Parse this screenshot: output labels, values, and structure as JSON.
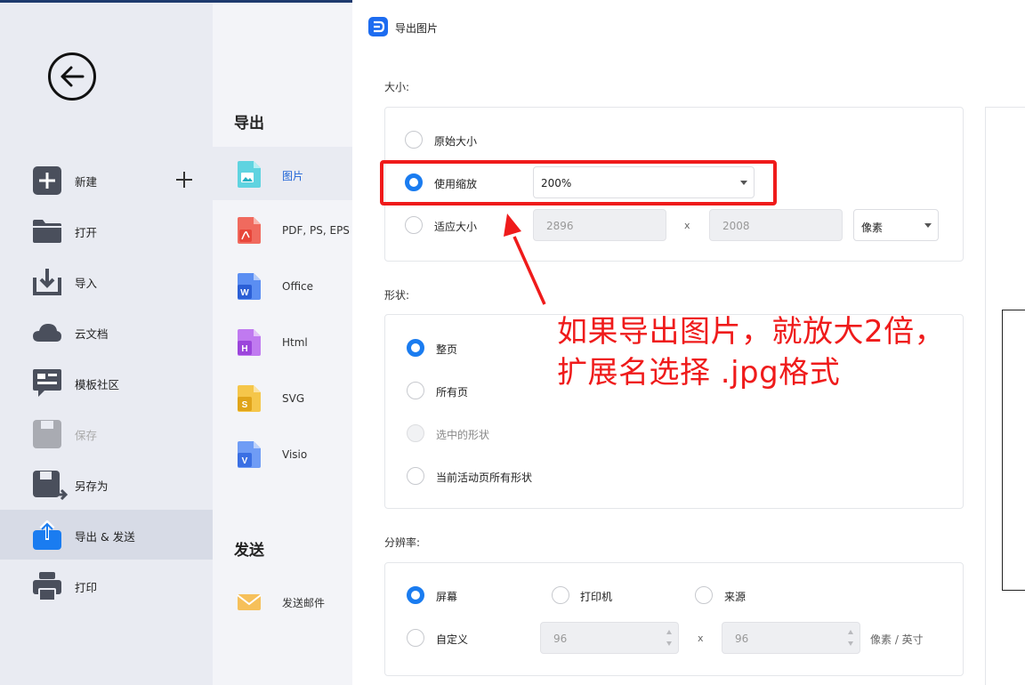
{
  "sidebar": {
    "items": [
      {
        "label": "新建",
        "icon": "new-icon"
      },
      {
        "label": "打开",
        "icon": "folder-icon"
      },
      {
        "label": "导入",
        "icon": "import-icon"
      },
      {
        "label": "云文档",
        "icon": "cloud-icon"
      },
      {
        "label": "模板社区",
        "icon": "template-icon"
      },
      {
        "label": "保存",
        "icon": "save-icon",
        "disabled": true
      },
      {
        "label": "另存为",
        "icon": "save-as-icon"
      },
      {
        "label": "导出 & 发送",
        "icon": "export-icon",
        "active": true
      },
      {
        "label": "打印",
        "icon": "print-icon"
      }
    ]
  },
  "export_menu": {
    "heading": "导出",
    "formats": [
      {
        "label": "图片",
        "icon": "image-file-icon",
        "active": true
      },
      {
        "label": "PDF, PS, EPS",
        "icon": "pdf-file-icon"
      },
      {
        "label": "Office",
        "icon": "word-file-icon"
      },
      {
        "label": "Html",
        "icon": "html-file-icon"
      },
      {
        "label": "SVG",
        "icon": "svg-file-icon"
      },
      {
        "label": "Visio",
        "icon": "visio-file-icon"
      }
    ],
    "send_heading": "发送",
    "send_items": [
      {
        "label": "发送邮件",
        "icon": "mail-icon"
      }
    ]
  },
  "dialog": {
    "title": "导出图片",
    "size": {
      "label": "大小:",
      "original": "原始大小",
      "scale": "使用缩放",
      "scale_value": "200%",
      "fit": "适应大小",
      "width": "2896",
      "times": "x",
      "height": "2008",
      "unit": "像素",
      "selected": "scale"
    },
    "shape": {
      "label": "形状:",
      "options": [
        "整页",
        "所有页",
        "选中的形状",
        "当前活动页所有形状"
      ],
      "selected": "整页"
    },
    "resolution": {
      "label": "分辨率:",
      "screen": "屏幕",
      "printer": "打印机",
      "source": "来源",
      "custom": "自定义",
      "dpi_x": "96",
      "times": "x",
      "dpi_y": "96",
      "unit": "像素 / 英寸",
      "selected": "screen"
    }
  },
  "annotation": {
    "line1": "如果导出图片，就放大2倍，",
    "line2": "扩展名选择 .jpg格式",
    "color": "#ef1b1b"
  },
  "colors": {
    "accent": "#1a7cf0",
    "sidebar_bg": "#e9ebf2",
    "annotation": "#ef1b1b"
  }
}
